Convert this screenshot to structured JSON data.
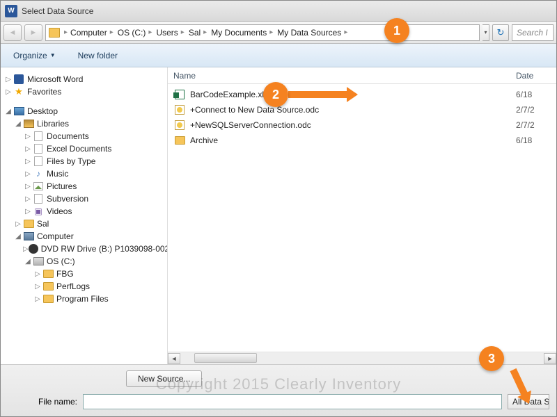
{
  "window": {
    "title": "Select Data Source"
  },
  "breadcrumb": {
    "items": [
      "Computer",
      "OS (C:)",
      "Users",
      "Sal",
      "My Documents",
      "My Data Sources"
    ]
  },
  "search": {
    "placeholder": "Search I"
  },
  "toolbar": {
    "organize": "Organize",
    "newfolder": "New folder"
  },
  "tree": {
    "word": "Microsoft Word",
    "favorites": "Favorites",
    "desktop": "Desktop",
    "libraries": "Libraries",
    "documents": "Documents",
    "excel_documents": "Excel Documents",
    "files_by_type": "Files by Type",
    "music": "Music",
    "pictures": "Pictures",
    "subversion": "Subversion",
    "videos": "Videos",
    "sal": "Sal",
    "computer": "Computer",
    "dvd": "DVD RW Drive (B:) P1039098-002",
    "osc": "OS (C:)",
    "fbg": "FBG",
    "perflogs": "PerfLogs",
    "program_files": "Program Files"
  },
  "columns": {
    "name": "Name",
    "date": "Date"
  },
  "files": [
    {
      "name": "BarCodeExample.xlsx",
      "date": "6/18",
      "icon": "xlsx"
    },
    {
      "name": "+Connect to New Data Source.odc",
      "date": "2/7/2",
      "icon": "odc"
    },
    {
      "name": "+NewSQLServerConnection.odc",
      "date": "2/7/2",
      "icon": "odc"
    },
    {
      "name": "Archive",
      "date": "6/18",
      "icon": "folder"
    }
  ],
  "bottom": {
    "new_source": "New Source...",
    "filename_label": "File name:",
    "filetype": "All Data S"
  },
  "callouts": {
    "c1": "1",
    "c2": "2",
    "c3": "3"
  },
  "watermark": "Copyright 2015 Clearly Inventory"
}
